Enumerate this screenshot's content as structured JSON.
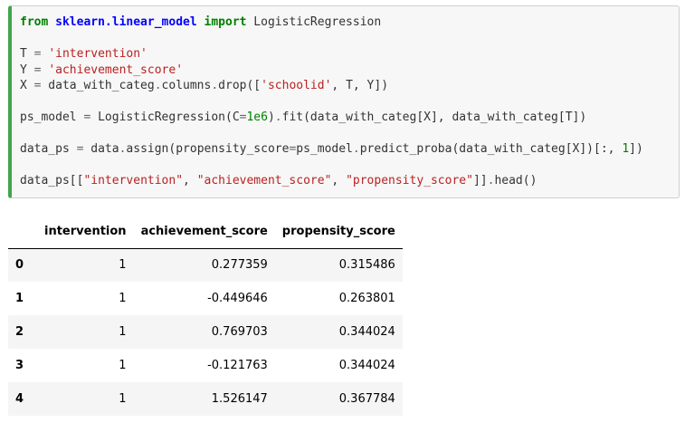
{
  "code_cell": {
    "lines": [
      [
        {
          "t": "from",
          "c": "kw"
        },
        {
          "t": " ",
          "c": ""
        },
        {
          "t": "sklearn.linear_model",
          "c": "mod"
        },
        {
          "t": " ",
          "c": ""
        },
        {
          "t": "import",
          "c": "kw"
        },
        {
          "t": " LogisticRegression",
          "c": ""
        }
      ],
      [],
      [
        {
          "t": "T ",
          "c": ""
        },
        {
          "t": "=",
          "c": "op"
        },
        {
          "t": " ",
          "c": ""
        },
        {
          "t": "'intervention'",
          "c": "str"
        }
      ],
      [
        {
          "t": "Y ",
          "c": ""
        },
        {
          "t": "=",
          "c": "op"
        },
        {
          "t": " ",
          "c": ""
        },
        {
          "t": "'achievement_score'",
          "c": "str"
        }
      ],
      [
        {
          "t": "X ",
          "c": ""
        },
        {
          "t": "=",
          "c": "op"
        },
        {
          "t": " data_with_categ",
          "c": ""
        },
        {
          "t": ".",
          "c": "op"
        },
        {
          "t": "columns",
          "c": ""
        },
        {
          "t": ".",
          "c": "op"
        },
        {
          "t": "drop([",
          "c": ""
        },
        {
          "t": "'schoolid'",
          "c": "str"
        },
        {
          "t": ", T, Y])",
          "c": ""
        }
      ],
      [],
      [
        {
          "t": "ps_model ",
          "c": ""
        },
        {
          "t": "=",
          "c": "op"
        },
        {
          "t": " LogisticRegression(C",
          "c": ""
        },
        {
          "t": "=",
          "c": "op"
        },
        {
          "t": "1e6",
          "c": "num"
        },
        {
          "t": ")",
          "c": ""
        },
        {
          "t": ".",
          "c": "op"
        },
        {
          "t": "fit(data_with_categ[X], data_with_categ[T])",
          "c": ""
        }
      ],
      [],
      [
        {
          "t": "data_ps ",
          "c": ""
        },
        {
          "t": "=",
          "c": "op"
        },
        {
          "t": " data",
          "c": ""
        },
        {
          "t": ".",
          "c": "op"
        },
        {
          "t": "assign(propensity_score",
          "c": ""
        },
        {
          "t": "=",
          "c": "op"
        },
        {
          "t": "ps_model",
          "c": ""
        },
        {
          "t": ".",
          "c": "op"
        },
        {
          "t": "predict_proba(data_with_categ[X])[:, ",
          "c": ""
        },
        {
          "t": "1",
          "c": "num"
        },
        {
          "t": "])",
          "c": ""
        }
      ],
      [],
      [
        {
          "t": "data_ps[[",
          "c": ""
        },
        {
          "t": "\"intervention\"",
          "c": "str"
        },
        {
          "t": ", ",
          "c": ""
        },
        {
          "t": "\"achievement_score\"",
          "c": "str"
        },
        {
          "t": ", ",
          "c": ""
        },
        {
          "t": "\"propensity_score\"",
          "c": "str"
        },
        {
          "t": "]]",
          "c": ""
        },
        {
          "t": ".",
          "c": "op"
        },
        {
          "t": "head()",
          "c": ""
        }
      ]
    ]
  },
  "output": {
    "columns": [
      "",
      "intervention",
      "achievement_score",
      "propensity_score"
    ],
    "rows": [
      {
        "index": "0",
        "cells": [
          "1",
          "0.277359",
          "0.315486"
        ]
      },
      {
        "index": "1",
        "cells": [
          "1",
          "-0.449646",
          "0.263801"
        ]
      },
      {
        "index": "2",
        "cells": [
          "1",
          "0.769703",
          "0.344024"
        ]
      },
      {
        "index": "3",
        "cells": [
          "1",
          "-0.121763",
          "0.344024"
        ]
      },
      {
        "index": "4",
        "cells": [
          "1",
          "1.526147",
          "0.367784"
        ]
      }
    ]
  },
  "colors": {
    "cell_background": "#f7f7f7",
    "cell_border_accent": "#42a44b",
    "keyword": "#008000",
    "module": "#0000ff",
    "string": "#ba2121",
    "number": "#008000",
    "operator": "#666666",
    "table_stripe": "#f5f5f5"
  }
}
